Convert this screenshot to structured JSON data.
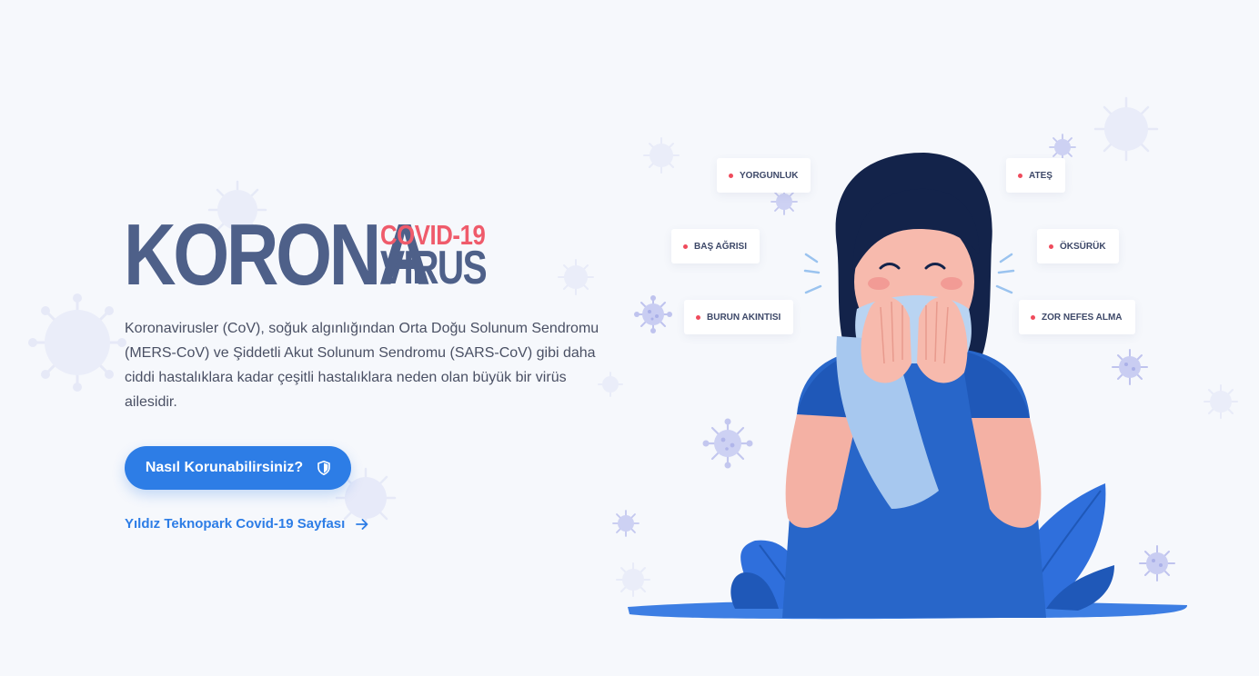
{
  "hero": {
    "title_main": "KORONA",
    "title_sub_top": "COVID-19",
    "title_sub_bottom": "VIRUS",
    "description": "Koronavirusler (CoV), soğuk algınlığından Orta Doğu Solunum Sendromu (MERS-CoV) ve Şiddetli Akut Solunum Sendromu (SARS-CoV) gibi daha ciddi hastalıklara kadar çeşitli hastalıklara neden olan büyük bir virüs ailesidir.",
    "cta_label": "Nasıl Korunabilirsiniz?",
    "cta_icon": "shield-icon",
    "link_label": "Yıldız Teknopark Covid-19 Sayfası",
    "link_icon": "arrow-right-icon"
  },
  "symptoms": [
    {
      "label": "YORGUNLUK"
    },
    {
      "label": "BAŞ AĞRISI"
    },
    {
      "label": "BURUN AKINTISI"
    },
    {
      "label": "ATEŞ"
    },
    {
      "label": "ÖKSÜRÜK"
    },
    {
      "label": "ZOR NEFES ALMA"
    }
  ],
  "colors": {
    "background": "#f6f8fc",
    "title": "#4e6089",
    "accent_red": "#ef5b6b",
    "primary_blue": "#2d7de6",
    "symptom_dot": "#ef4b5c"
  }
}
